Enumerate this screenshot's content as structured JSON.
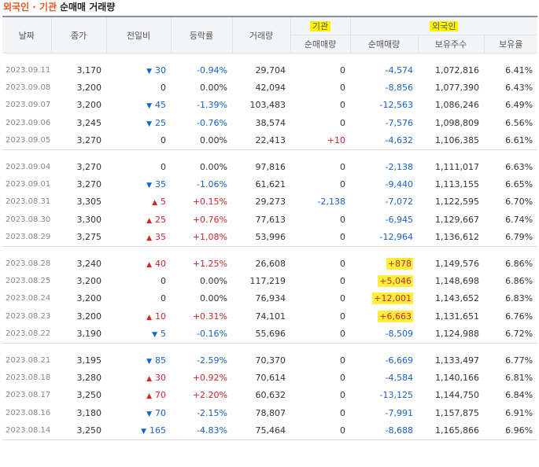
{
  "title": {
    "part1": "외국인 · 기관",
    "part2": "순매매 거래량"
  },
  "headers": {
    "date": "날짜",
    "close": "종가",
    "change": "전일비",
    "rate": "등락률",
    "volume": "거래량",
    "inst_group": "기관",
    "inst_net": "순매매량",
    "foreign_group": "외국인",
    "foreign_net": "순매매량",
    "foreign_hold": "보유주수",
    "foreign_ratio": "보유율"
  },
  "groups": [
    [
      {
        "date": "2023.09.11",
        "close": "3,170",
        "dir": "down",
        "change": "30",
        "rate": "-0.94%",
        "volume": "29,704",
        "inst": "0",
        "foreign": "-4,574",
        "hold": "1,072,816",
        "ratio": "6.41%",
        "mark": false
      },
      {
        "date": "2023.09.08",
        "close": "3,200",
        "dir": "flat",
        "change": "0",
        "rate": "0.00%",
        "volume": "42,094",
        "inst": "0",
        "foreign": "-8,856",
        "hold": "1,077,390",
        "ratio": "6.43%",
        "mark": false
      },
      {
        "date": "2023.09.07",
        "close": "3,200",
        "dir": "down",
        "change": "45",
        "rate": "-1.39%",
        "volume": "103,483",
        "inst": "0",
        "foreign": "-12,563",
        "hold": "1,086,246",
        "ratio": "6.49%",
        "mark": false
      },
      {
        "date": "2023.09.06",
        "close": "3,245",
        "dir": "down",
        "change": "25",
        "rate": "-0.76%",
        "volume": "38,574",
        "inst": "0",
        "foreign": "-7,576",
        "hold": "1,098,809",
        "ratio": "6.56%",
        "mark": false
      },
      {
        "date": "2023.09.05",
        "close": "3,270",
        "dir": "flat",
        "change": "0",
        "rate": "0.00%",
        "volume": "22,413",
        "inst": "+10",
        "foreign": "-4,632",
        "hold": "1,106,385",
        "ratio": "6.61%",
        "mark": false
      }
    ],
    [
      {
        "date": "2023.09.04",
        "close": "3,270",
        "dir": "flat",
        "change": "0",
        "rate": "0.00%",
        "volume": "97,816",
        "inst": "0",
        "foreign": "-2,138",
        "hold": "1,111,017",
        "ratio": "6.63%",
        "mark": false
      },
      {
        "date": "2023.09.01",
        "close": "3,270",
        "dir": "down",
        "change": "35",
        "rate": "-1.06%",
        "volume": "61,621",
        "inst": "0",
        "foreign": "-9,440",
        "hold": "1,113,155",
        "ratio": "6.65%",
        "mark": false
      },
      {
        "date": "2023.08.31",
        "close": "3,305",
        "dir": "up",
        "change": "5",
        "rate": "+0.15%",
        "volume": "29,273",
        "inst": "-2,138",
        "foreign": "-7,072",
        "hold": "1,122,595",
        "ratio": "6.70%",
        "mark": false
      },
      {
        "date": "2023.08.30",
        "close": "3,300",
        "dir": "up",
        "change": "25",
        "rate": "+0.76%",
        "volume": "77,613",
        "inst": "0",
        "foreign": "-6,945",
        "hold": "1,129,667",
        "ratio": "6.74%",
        "mark": false
      },
      {
        "date": "2023.08.29",
        "close": "3,275",
        "dir": "up",
        "change": "35",
        "rate": "+1.08%",
        "volume": "53,996",
        "inst": "0",
        "foreign": "-12,964",
        "hold": "1,136,612",
        "ratio": "6.79%",
        "mark": false
      }
    ],
    [
      {
        "date": "2023.08.28",
        "close": "3,240",
        "dir": "up",
        "change": "40",
        "rate": "+1.25%",
        "volume": "26,608",
        "inst": "0",
        "foreign": "+878",
        "hold": "1,149,576",
        "ratio": "6.86%",
        "mark": true
      },
      {
        "date": "2023.08.25",
        "close": "3,200",
        "dir": "flat",
        "change": "0",
        "rate": "0.00%",
        "volume": "117,219",
        "inst": "0",
        "foreign": "+5,046",
        "hold": "1,148,698",
        "ratio": "6.86%",
        "mark": true
      },
      {
        "date": "2023.08.24",
        "close": "3,200",
        "dir": "flat",
        "change": "0",
        "rate": "0.00%",
        "volume": "76,934",
        "inst": "0",
        "foreign": "+12,001",
        "hold": "1,143,652",
        "ratio": "6.83%",
        "mark": true
      },
      {
        "date": "2023.08.23",
        "close": "3,200",
        "dir": "up",
        "change": "10",
        "rate": "+0.31%",
        "volume": "74,101",
        "inst": "0",
        "foreign": "+6,663",
        "hold": "1,131,651",
        "ratio": "6.76%",
        "mark": true
      },
      {
        "date": "2023.08.22",
        "close": "3,190",
        "dir": "down",
        "change": "5",
        "rate": "-0.16%",
        "volume": "55,696",
        "inst": "0",
        "foreign": "-8,509",
        "hold": "1,124,988",
        "ratio": "6.72%",
        "mark": false
      }
    ],
    [
      {
        "date": "2023.08.21",
        "close": "3,195",
        "dir": "down",
        "change": "85",
        "rate": "-2.59%",
        "volume": "70,370",
        "inst": "0",
        "foreign": "-6,669",
        "hold": "1,133,497",
        "ratio": "6.77%",
        "mark": false
      },
      {
        "date": "2023.08.18",
        "close": "3,280",
        "dir": "up",
        "change": "30",
        "rate": "+0.92%",
        "volume": "70,614",
        "inst": "0",
        "foreign": "-4,584",
        "hold": "1,140,166",
        "ratio": "6.81%",
        "mark": false
      },
      {
        "date": "2023.08.17",
        "close": "3,250",
        "dir": "up",
        "change": "70",
        "rate": "+2.20%",
        "volume": "60,632",
        "inst": "0",
        "foreign": "-13,125",
        "hold": "1,144,750",
        "ratio": "6.84%",
        "mark": false
      },
      {
        "date": "2023.08.16",
        "close": "3,180",
        "dir": "down",
        "change": "70",
        "rate": "-2.15%",
        "volume": "78,807",
        "inst": "0",
        "foreign": "-7,991",
        "hold": "1,157,875",
        "ratio": "6.91%",
        "mark": false
      },
      {
        "date": "2023.08.14",
        "close": "3,250",
        "dir": "down",
        "change": "165",
        "rate": "-4.83%",
        "volume": "75,464",
        "inst": "0",
        "foreign": "-8,688",
        "hold": "1,165,866",
        "ratio": "6.96%",
        "mark": false
      }
    ]
  ],
  "colors": {
    "up": "#d2242b",
    "down": "#1762c9",
    "highlight": "#fff200",
    "title_accent": "#e8541e"
  }
}
